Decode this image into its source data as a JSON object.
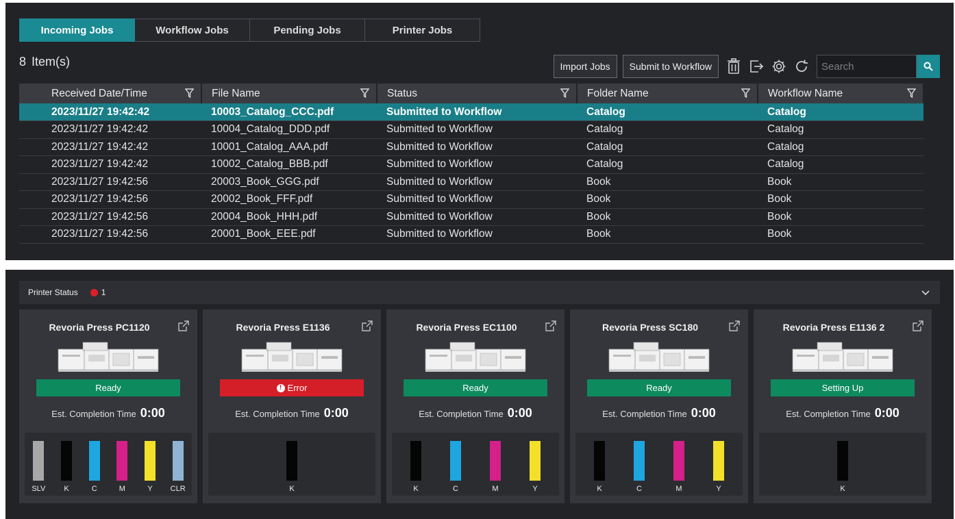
{
  "tabs": [
    {
      "label": "Incoming Jobs",
      "active": true
    },
    {
      "label": "Workflow Jobs",
      "active": false
    },
    {
      "label": "Pending Jobs",
      "active": false
    },
    {
      "label": "Printer Jobs",
      "active": false
    }
  ],
  "item_count": {
    "number": "8",
    "label": "Item(s)"
  },
  "toolbar": {
    "import_label": "Import Jobs",
    "submit_label": "Submit to Workflow",
    "search_placeholder": "Search",
    "icons": [
      "trash-icon",
      "export-icon",
      "gear-icon",
      "refresh-icon",
      "search-icon"
    ]
  },
  "table": {
    "columns": [
      "Received Date/Time",
      "File Name",
      "Status",
      "Folder Name",
      "Workflow Name"
    ],
    "rows": [
      [
        "2023/11/27 19:42:42",
        "10003_Catalog_CCC.pdf",
        "Submitted to Workflow",
        "Catalog",
        "Catalog"
      ],
      [
        "2023/11/27 19:42:42",
        "10004_Catalog_DDD.pdf",
        "Submitted to Workflow",
        "Catalog",
        "Catalog"
      ],
      [
        "2023/11/27 19:42:42",
        "10001_Catalog_AAA.pdf",
        "Submitted to Workflow",
        "Catalog",
        "Catalog"
      ],
      [
        "2023/11/27 19:42:42",
        "10002_Catalog_BBB.pdf",
        "Submitted to Workflow",
        "Catalog",
        "Catalog"
      ],
      [
        "2023/11/27 19:42:56",
        "20003_Book_GGG.pdf",
        "Submitted to Workflow",
        "Book",
        "Book"
      ],
      [
        "2023/11/27 19:42:56",
        "20002_Book_FFF.pdf",
        "Submitted to Workflow",
        "Book",
        "Book"
      ],
      [
        "2023/11/27 19:42:56",
        "20004_Book_HHH.pdf",
        "Submitted to Workflow",
        "Book",
        "Book"
      ],
      [
        "2023/11/27 19:42:56",
        "20001_Book_EEE.pdf",
        "Submitted to Workflow",
        "Book",
        "Book"
      ]
    ],
    "selected_row": 0
  },
  "printer_status": {
    "title": "Printer Status",
    "error_count": "1",
    "est_label": "Est. Completion Time",
    "printers": [
      {
        "name": "Revoria Press PC1120",
        "status": "Ready",
        "status_color": "#0e8a5f",
        "est_time": "0:00",
        "inks": [
          {
            "label": "SLV",
            "color": "#a8a8a8"
          },
          {
            "label": "K",
            "color": "#050505"
          },
          {
            "label": "C",
            "color": "#1ea6df"
          },
          {
            "label": "M",
            "color": "#d5208a"
          },
          {
            "label": "Y",
            "color": "#f2e02a"
          },
          {
            "label": "CLR",
            "color": "#8fb3d1"
          }
        ]
      },
      {
        "name": "Revoria Press E1136",
        "status": "Error",
        "status_color": "#d51f28",
        "est_time": "0:00",
        "inks": [
          {
            "label": "K",
            "color": "#050505"
          }
        ]
      },
      {
        "name": "Revoria Press EC1100",
        "status": "Ready",
        "status_color": "#0e8a5f",
        "est_time": "0:00",
        "inks": [
          {
            "label": "K",
            "color": "#050505"
          },
          {
            "label": "C",
            "color": "#1ea6df"
          },
          {
            "label": "M",
            "color": "#d5208a"
          },
          {
            "label": "Y",
            "color": "#f2e02a"
          }
        ]
      },
      {
        "name": "Revoria Press SC180",
        "status": "Ready",
        "status_color": "#0e8a5f",
        "est_time": "0:00",
        "inks": [
          {
            "label": "K",
            "color": "#050505"
          },
          {
            "label": "C",
            "color": "#1ea6df"
          },
          {
            "label": "M",
            "color": "#d5208a"
          },
          {
            "label": "Y",
            "color": "#f2e02a"
          }
        ]
      },
      {
        "name": "Revoria Press E1136 2",
        "status": "Setting Up",
        "status_color": "#0e8a5f",
        "est_time": "0:00",
        "inks": [
          {
            "label": "K",
            "color": "#050505"
          }
        ]
      }
    ]
  }
}
